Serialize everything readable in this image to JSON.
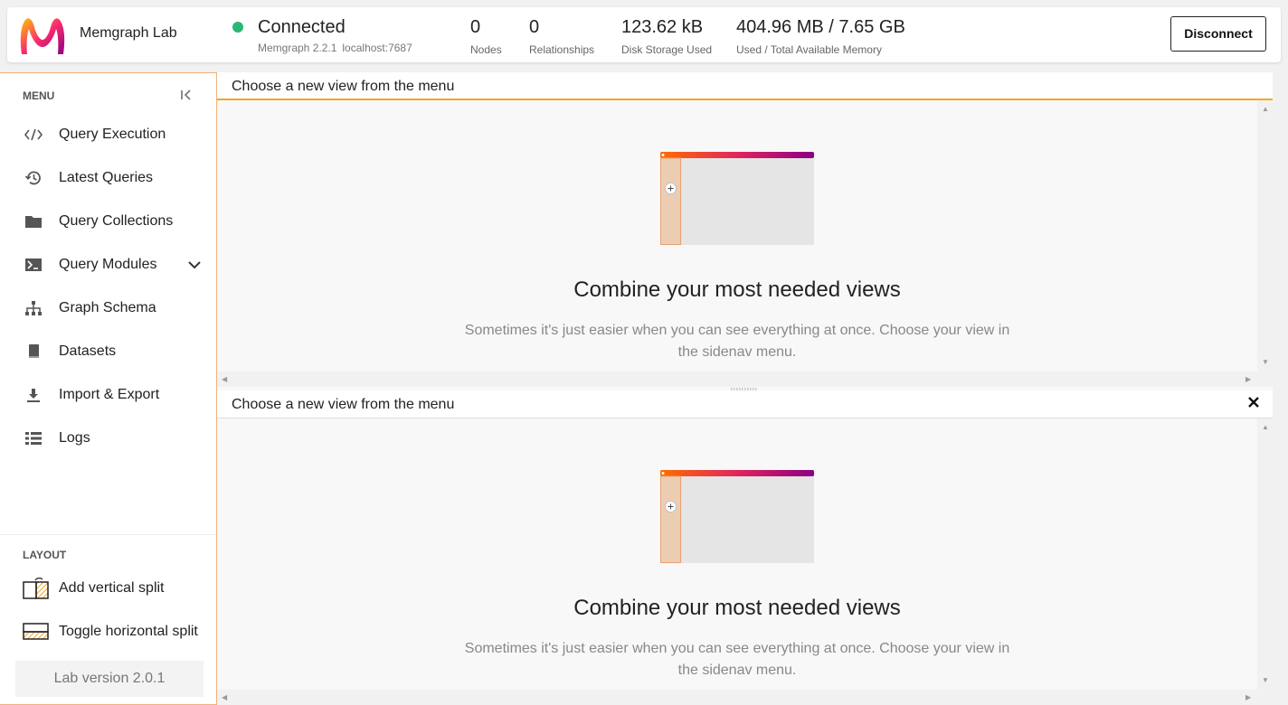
{
  "header": {
    "app_name": "Memgraph Lab",
    "status": "Connected",
    "status_color": "#2bb673",
    "version": "Memgraph 2.2.1",
    "host": "localhost:7687",
    "stats": [
      {
        "value": "0",
        "label": "Nodes"
      },
      {
        "value": "0",
        "label": "Relationships"
      },
      {
        "value": "123.62 kB",
        "label": "Disk Storage Used"
      },
      {
        "value": "404.96 MB / 7.65 GB",
        "label": "Used / Total Available Memory"
      }
    ],
    "disconnect_label": "Disconnect"
  },
  "sidebar": {
    "menu_title": "MENU",
    "items": [
      {
        "label": "Query Execution",
        "icon": "code-icon"
      },
      {
        "label": "Latest Queries",
        "icon": "history-icon"
      },
      {
        "label": "Query Collections",
        "icon": "folder-icon"
      },
      {
        "label": "Query Modules",
        "icon": "terminal-icon"
      },
      {
        "label": "Graph Schema",
        "icon": "schema-icon"
      },
      {
        "label": "Datasets",
        "icon": "book-icon"
      },
      {
        "label": "Import & Export",
        "icon": "download-icon"
      },
      {
        "label": "Logs",
        "icon": "list-icon"
      }
    ],
    "layout_title": "LAYOUT",
    "layout_items": [
      {
        "label": "Add vertical split",
        "icon": "vertical-split-icon"
      },
      {
        "label": "Toggle horizontal split",
        "icon": "horizontal-split-icon"
      }
    ],
    "version_label": "Lab version 2.0.1"
  },
  "panels": [
    {
      "title": "Choose a new view from the menu",
      "heading": "Combine your most needed views",
      "description": "Sometimes it's just easier when you can see everything at once. Choose your view in the sidenav menu."
    },
    {
      "title": "Choose a new view from the menu",
      "heading": "Combine your most needed views",
      "description": "Sometimes it's just easier when you can see everything at once. Choose your view in the sidenav menu."
    }
  ],
  "colors": {
    "accent": "#f5a623",
    "brand_orange": "#fb6e00",
    "brand_purple": "#8c0082",
    "sidebar_border": "#f0b27a"
  }
}
